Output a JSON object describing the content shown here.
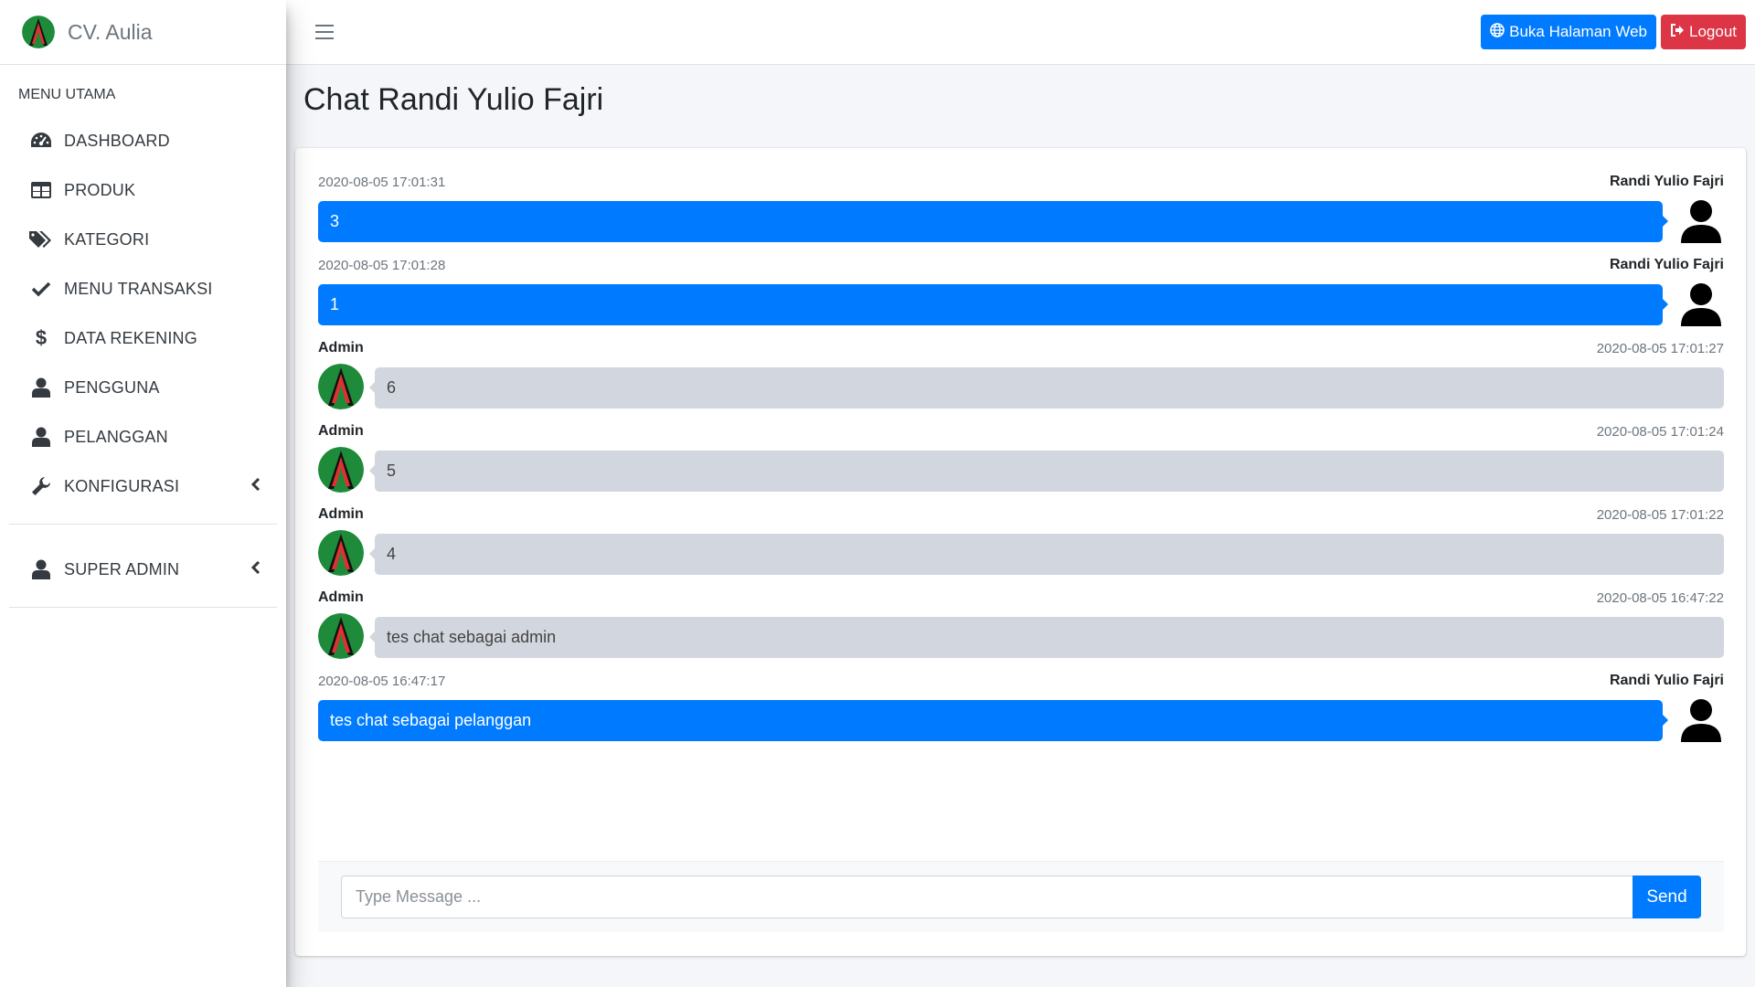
{
  "brand": {
    "name": "CV. Aulia"
  },
  "sidebar": {
    "header": "MENU UTAMA",
    "items": [
      {
        "label": "DASHBOARD",
        "icon": "dashboard-gauge-icon"
      },
      {
        "label": "PRODUK",
        "icon": "table-icon"
      },
      {
        "label": "KATEGORI",
        "icon": "tags-icon"
      },
      {
        "label": "MENU TRANSAKSI",
        "icon": "check-icon"
      },
      {
        "label": "DATA REKENING",
        "icon": "dollar-icon"
      },
      {
        "label": "PENGGUNA",
        "icon": "user-icon"
      },
      {
        "label": "PELANGGAN",
        "icon": "user-icon"
      },
      {
        "label": "KONFIGURASI",
        "icon": "wrench-icon",
        "expandable": true
      }
    ],
    "super_admin": {
      "label": "SUPER ADMIN",
      "icon": "user-icon",
      "expandable": true
    }
  },
  "topbar": {
    "open_web_label": "Buka Halaman Web",
    "logout_label": "Logout"
  },
  "page": {
    "title": "Chat Randi Yulio Fajri"
  },
  "messages": [
    {
      "side": "right",
      "name": "Randi Yulio Fajri",
      "time": "2020-08-05 17:01:31",
      "text": "3"
    },
    {
      "side": "right",
      "name": "Randi Yulio Fajri",
      "time": "2020-08-05 17:01:28",
      "text": "1"
    },
    {
      "side": "left",
      "name": "Admin",
      "time": "2020-08-05 17:01:27",
      "text": "6"
    },
    {
      "side": "left",
      "name": "Admin",
      "time": "2020-08-05 17:01:24",
      "text": "5"
    },
    {
      "side": "left",
      "name": "Admin",
      "time": "2020-08-05 17:01:22",
      "text": "4"
    },
    {
      "side": "left",
      "name": "Admin",
      "time": "2020-08-05 16:47:22",
      "text": "tes chat sebagai admin"
    },
    {
      "side": "right",
      "name": "Randi Yulio Fajri",
      "time": "2020-08-05 16:47:17",
      "text": "tes chat sebagai pelanggan"
    }
  ],
  "composer": {
    "placeholder": "Type Message ...",
    "value": "",
    "send_label": "Send"
  },
  "colors": {
    "primary": "#007bff",
    "danger": "#dc3545",
    "admin_bubble": "#d2d6de",
    "logo_green": "#1e8b3a",
    "logo_red": "#e03131"
  }
}
